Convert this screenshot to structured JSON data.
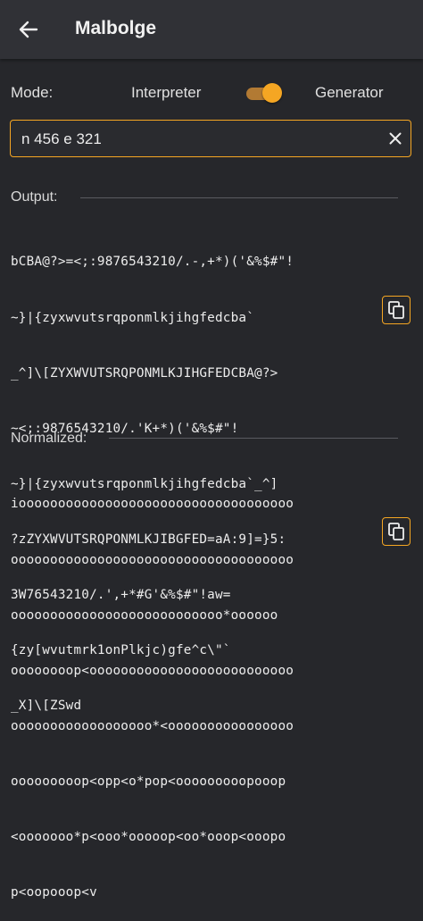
{
  "appbar": {
    "title": "Malbolge",
    "back_icon": "arrow-left-icon"
  },
  "mode": {
    "label": "Mode:",
    "left_option": "Interpreter",
    "right_option": "Generator",
    "selected": "Generator",
    "accent_color": "#f5a623"
  },
  "input": {
    "value": "n 456 e 321",
    "clear_icon": "close-icon"
  },
  "output": {
    "label": "Output:",
    "lines": [
      "bCBA@?>=<;:9876543210/.-,+*)('&%$#\"!",
      "~}|{zyxwvutsrqponmlkjihgfedcba`",
      "_^]\\[ZYXWVUTSRQPONMLKJIHGFEDCBA@?>",
      "~<;:9876543210/.'K+*)('&%$#\"!",
      "~}|{zyxwvutsrqponmlkjihgfedcba`_^]",
      "?zZYXWVUTSRQPONMLKJIBGFED=aA:9]=}5:",
      "3W76543210/.',+*#G'&%$#\"!aw=",
      "{zy[wvutmrk1onPlkjc)gfe^c\\\"`",
      "_X]\\[ZSwd"
    ],
    "copy_icon": "copy-icon"
  },
  "normalized": {
    "label": "Normalized:",
    "lines": [
      "iooooooooooooooooooooooooooooooooooo",
      "oooooooooooooooooooooooooooooooooooo",
      "ooooooooooooooooooooooooooo*oooooo",
      "oooooooop<oooooooooooooooooooooooooo",
      "oooooooooooooooooo*<oooooooooooooooo",
      "ooooooooop<opp<o*pop<ooooooooopooop",
      "<ooooooo*p<ooo*ooooop<oo*ooop<ooopo",
      "p<oopooop<v"
    ],
    "copy_icon": "copy-icon"
  }
}
